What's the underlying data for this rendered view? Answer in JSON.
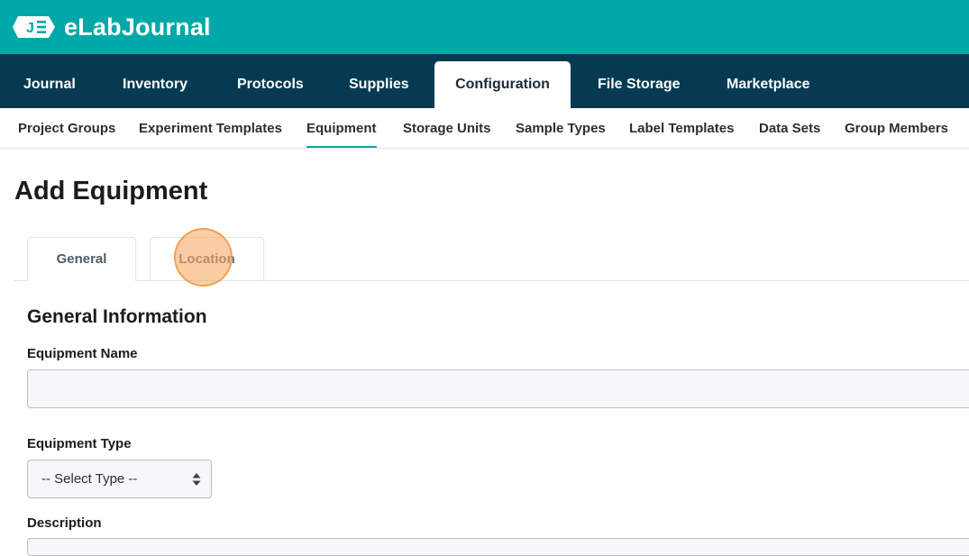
{
  "brand": {
    "logo_letter": "J",
    "name": "eLabJournal",
    "color": "#00a8a8"
  },
  "main_nav": {
    "background": "#073a52",
    "items": [
      {
        "label": "Journal"
      },
      {
        "label": "Inventory"
      },
      {
        "label": "Protocols"
      },
      {
        "label": "Supplies"
      },
      {
        "label": "Configuration",
        "active": true
      },
      {
        "label": "File Storage"
      },
      {
        "label": "Marketplace"
      }
    ]
  },
  "sub_nav": {
    "items": [
      {
        "label": "Project Groups"
      },
      {
        "label": "Experiment Templates"
      },
      {
        "label": "Equipment",
        "active": true
      },
      {
        "label": "Storage Units"
      },
      {
        "label": "Sample Types"
      },
      {
        "label": "Label Templates"
      },
      {
        "label": "Data Sets"
      },
      {
        "label": "Group Members"
      }
    ],
    "accent": "#13a6a8"
  },
  "page": {
    "title": "Add Equipment",
    "tabs": [
      {
        "label": "General",
        "active": true
      },
      {
        "label": "Location"
      }
    ]
  },
  "form": {
    "section_title": "General Information",
    "equipment_name": {
      "label": "Equipment Name",
      "value": ""
    },
    "equipment_type": {
      "label": "Equipment Type",
      "selected": "-- Select Type --"
    },
    "description": {
      "label": "Description"
    }
  },
  "click_marker": {
    "color": "#f6a45a",
    "target": "Location"
  }
}
